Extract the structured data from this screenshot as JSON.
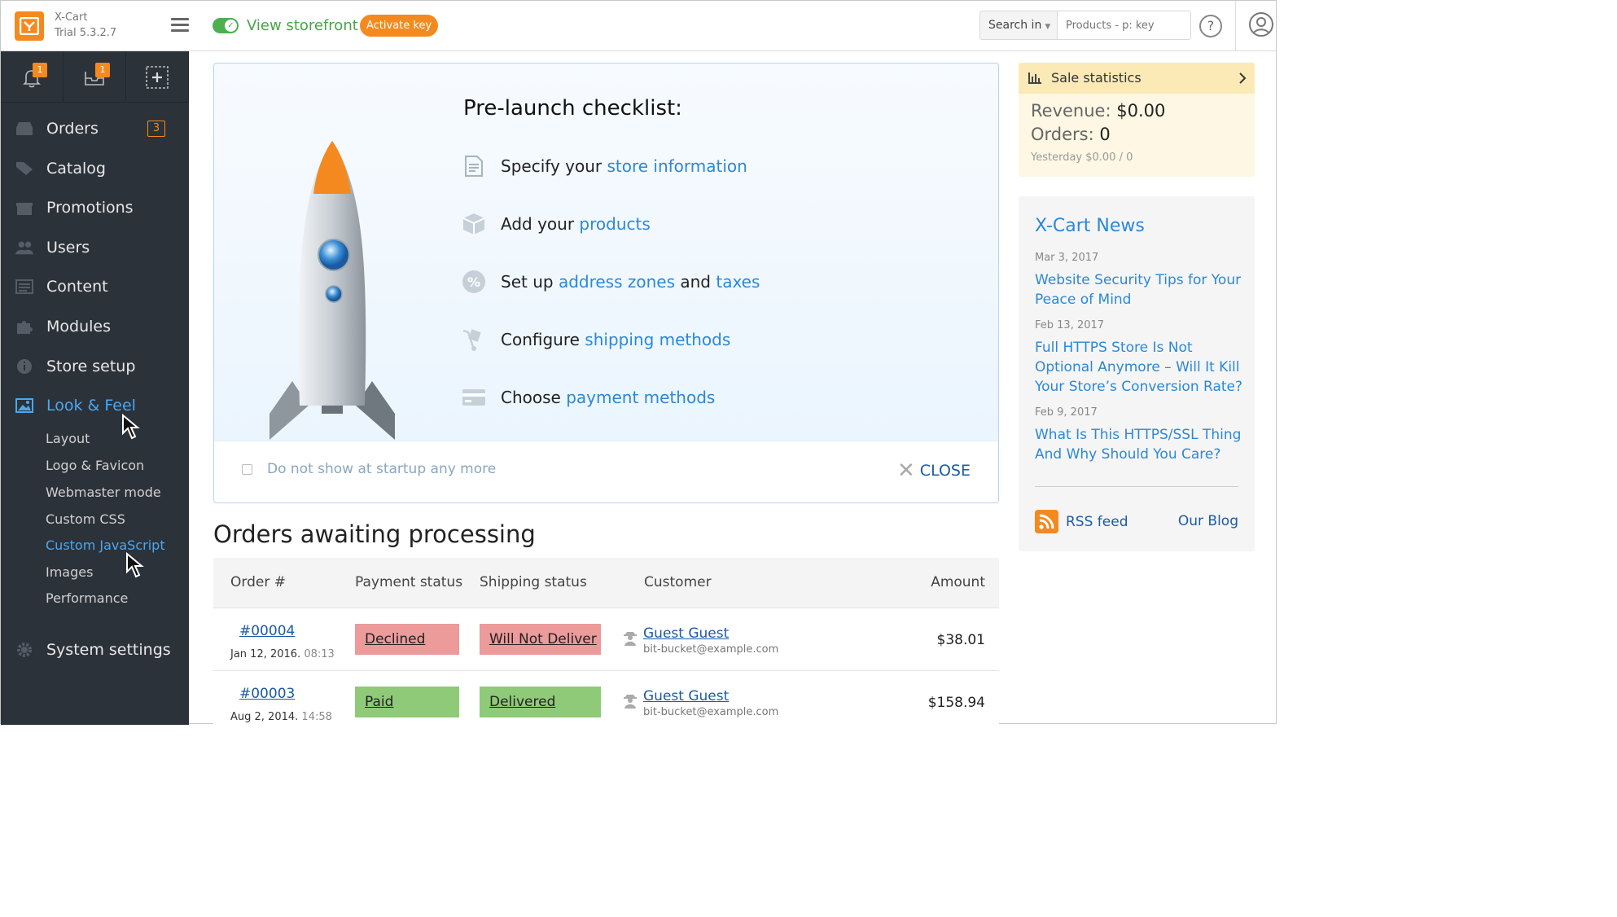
{
  "header": {
    "brand_name": "X-Cart",
    "brand_version": "Trial 5.3.2.7",
    "view_storefront": "View storefront",
    "activate_key": "Activate key",
    "search_in": "Search in",
    "search_placeholder": "Products - p: key",
    "help": "?"
  },
  "sidebar": {
    "notifications_count": "1",
    "orders_quick_count": "1",
    "items": [
      {
        "label": "Orders",
        "badge": "3"
      },
      {
        "label": "Catalog"
      },
      {
        "label": "Promotions"
      },
      {
        "label": "Users"
      },
      {
        "label": "Content"
      },
      {
        "label": "Modules"
      },
      {
        "label": "Store setup"
      },
      {
        "label": "Look & Feel"
      },
      {
        "label": "System settings"
      }
    ],
    "subitems": [
      "Layout",
      "Logo & Favicon",
      "Webmaster mode",
      "Custom CSS",
      "Custom JavaScript",
      "Images",
      "Performance"
    ]
  },
  "checklist": {
    "title": "Pre-launch checklist:",
    "items": [
      {
        "prefix": "Specify your ",
        "link": "store information"
      },
      {
        "prefix": "Add your ",
        "link": "products"
      },
      {
        "prefix": "Set up ",
        "link": "address zones",
        "mid": " and ",
        "link2": "taxes"
      },
      {
        "prefix": "Configure ",
        "link": "shipping methods"
      },
      {
        "prefix": "Choose ",
        "link": "payment methods"
      }
    ],
    "do_not_show": "Do not show at startup any more",
    "close": "CLOSE"
  },
  "orders": {
    "title": "Orders awaiting processing",
    "columns": [
      "Order #",
      "Payment status",
      "Shipping status",
      "Customer",
      "Amount"
    ],
    "rows": [
      {
        "number": "#00004",
        "date": "Jan 12, 2016.",
        "time": "08:13",
        "payment": "Declined",
        "shipping": "Will Not Deliver",
        "customer": "Guest Guest",
        "email": "bit-bucket@example.com",
        "amount": "$38.01"
      },
      {
        "number": "#00003",
        "date": "Aug 2, 2014.",
        "time": "14:58",
        "payment": "Paid",
        "shipping": "Delivered",
        "customer": "Guest Guest",
        "email": "bit-bucket@example.com",
        "amount": "$158.94"
      }
    ]
  },
  "stats": {
    "title": "Sale statistics",
    "revenue_label": "Revenue:",
    "revenue_value": "$0.00",
    "orders_label": "Orders:",
    "orders_value": "0",
    "yesterday": "Yesterday $0.00 / 0"
  },
  "news": {
    "title": "X-Cart News",
    "items": [
      {
        "date": "Mar 3, 2017",
        "title": "Website Security Tips for Your Peace of Mind"
      },
      {
        "date": "Feb 13, 2017",
        "title": "Full HTTPS Store Is Not Optional Anymore – Will It Kill Your Store’s Conversion Rate?"
      },
      {
        "date": "Feb 9, 2017",
        "title": "What Is This HTTPS/SSL Thing And Why Should You Care?"
      }
    ],
    "rss": "RSS feed",
    "blog": "Our Blog"
  },
  "colors": {
    "accent_orange": "#f48a1f",
    "link_blue": "#2b88d8",
    "sidebar_bg": "#2c323a",
    "storefront_green": "#47a447"
  }
}
